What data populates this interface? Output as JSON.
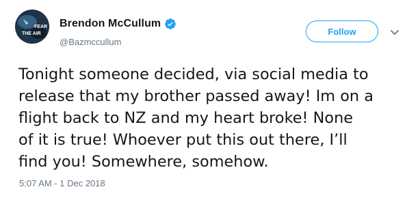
{
  "author": {
    "display_name": "Brendon McCullum",
    "handle": "@Bazmccullum",
    "verified": true,
    "avatar_text_1": "FEAR",
    "avatar_text_2": "THE AIR"
  },
  "actions": {
    "follow_label": "Follow",
    "more_icon": "chevron-down-icon"
  },
  "tweet": {
    "lines": [
      "Tonight someone decided, via social media to",
      "release that my brother passed away! Im on a",
      "flight back to NZ and my heart broke! None",
      "of it is true! Whoever put this out there, I’ll",
      "find you! Somewhere, somehow."
    ],
    "timestamp": "5:07 AM - 1 Dec 2018"
  },
  "colors": {
    "accent": "#1da1f2",
    "text": "#14171a",
    "muted": "#657786"
  }
}
